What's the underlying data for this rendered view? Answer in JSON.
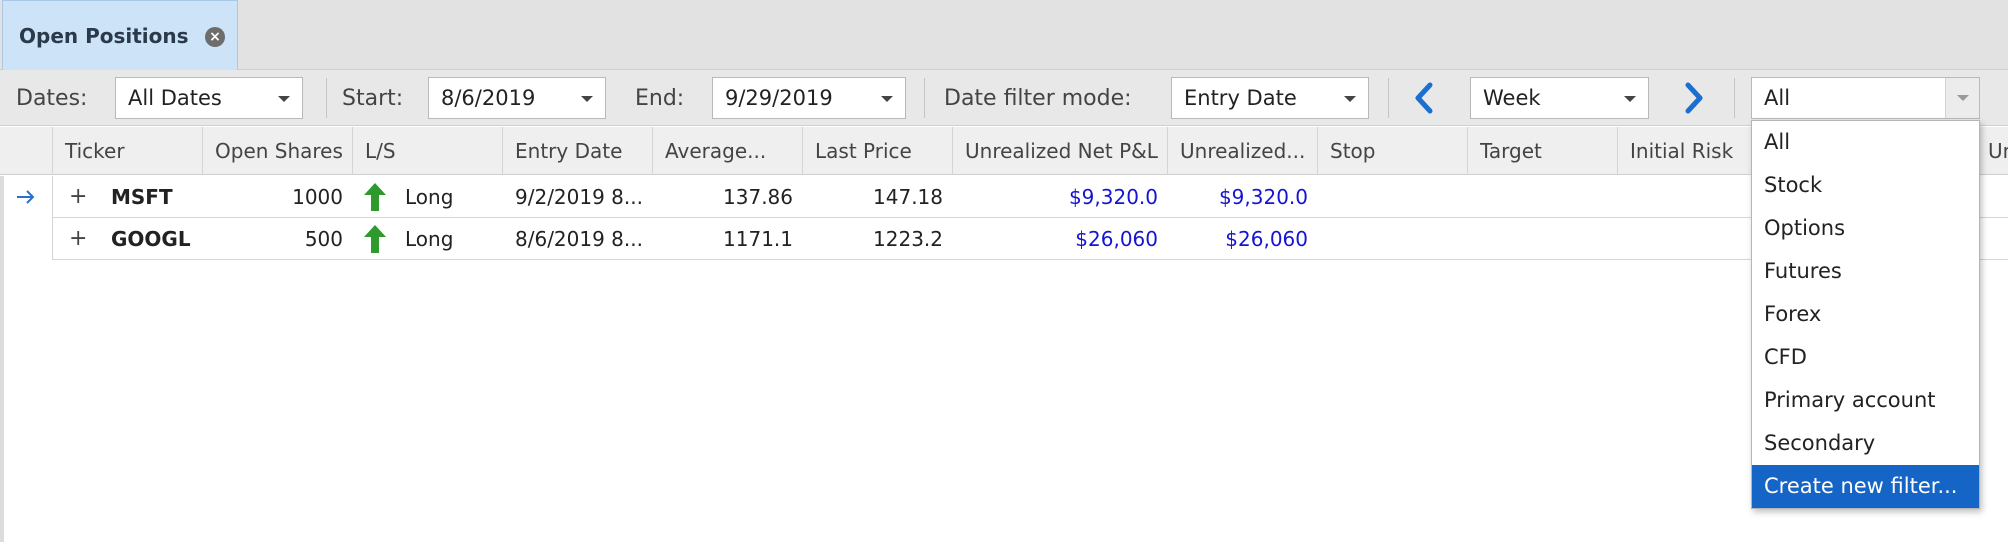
{
  "tab": {
    "title": "Open Positions",
    "close_symbol": "×"
  },
  "toolbar": {
    "dates_label": "Dates:",
    "dates_value": "All Dates",
    "start_label": "Start:",
    "start_value": "8/6/2019",
    "end_label": "End:",
    "end_value": "9/29/2019",
    "mode_label": "Date filter mode:",
    "mode_value": "Entry Date",
    "period_value": "Week",
    "filter_value": "All"
  },
  "columns": [
    "Ticker",
    "Open Shares",
    "L/S",
    "Entry Date",
    "Average...",
    "Last Price",
    "Unrealized Net P&L",
    "Unrealized...",
    "Stop",
    "Target",
    "Initial Risk",
    "Unrealized"
  ],
  "rows": [
    {
      "expander": "+",
      "ticker": "MSFT",
      "open_shares": "1000",
      "side": "Long",
      "entry_date": "9/2/2019 8...",
      "average": "137.86",
      "last_price": "147.18",
      "unrealized_net": "$9,320.0",
      "unrealized_2": "$9,320.0"
    },
    {
      "expander": "+",
      "ticker": "GOOGL",
      "open_shares": "500",
      "side": "Long",
      "entry_date": "8/6/2019 8...",
      "average": "1171.1",
      "last_price": "1223.2",
      "unrealized_net": "$26,060",
      "unrealized_2": "$26,060"
    }
  ],
  "filter_dropdown": {
    "items": [
      "All",
      "Stock",
      "Options",
      "Futures",
      "Forex",
      "CFD",
      "Primary account",
      "Secondary",
      "Create new filter..."
    ],
    "selected_index": 8
  },
  "colors": {
    "accent": "#1565c6",
    "pnl_blue": "#1414d2",
    "long_arrow": "#2e9a2e",
    "tab_bg": "#cde3f8"
  },
  "icons": {
    "row_indicator": "arrow-right-icon",
    "side": "up-arrow-icon",
    "prev": "chevron-left-icon",
    "next": "chevron-right-icon"
  }
}
